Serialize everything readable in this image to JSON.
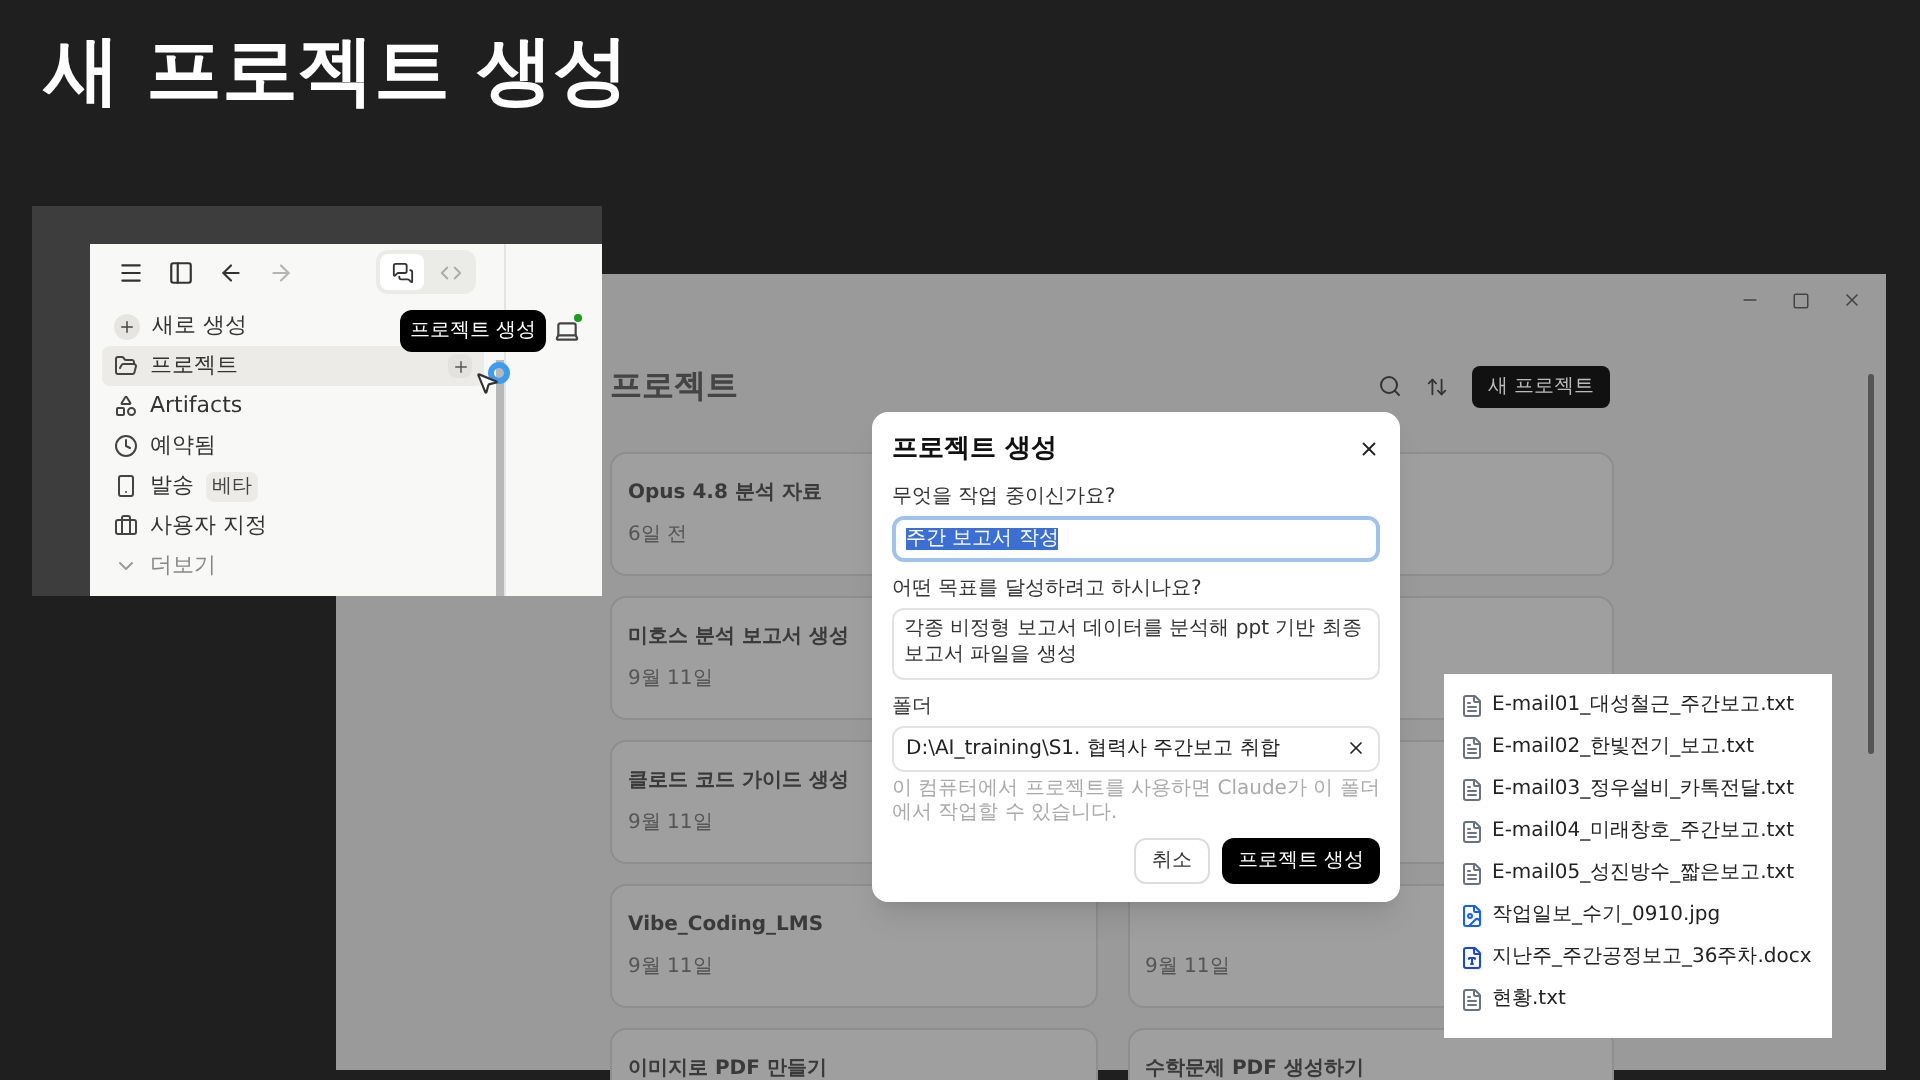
{
  "slide_title": "새 프로젝트 생성",
  "sidebar": {
    "nav": [
      {
        "kind": "menu",
        "disabled": false
      },
      {
        "kind": "panel",
        "disabled": false
      },
      {
        "kind": "back",
        "disabled": false
      },
      {
        "kind": "forward",
        "disabled": true
      }
    ],
    "mode_toggle": [
      {
        "kind": "chat",
        "selected": true
      },
      {
        "kind": "code",
        "selected": false
      }
    ],
    "items": [
      {
        "kind": "new",
        "label": "새로 생성",
        "selected": false
      },
      {
        "kind": "projects",
        "label": "프로젝트",
        "selected": true
      },
      {
        "kind": "artifacts",
        "label": "Artifacts",
        "selected": false
      },
      {
        "kind": "scheduled",
        "label": "예약됨",
        "selected": false
      },
      {
        "kind": "dispatch",
        "label": "발송",
        "badge": "베타",
        "selected": false
      },
      {
        "kind": "customize",
        "label": "사용자 지정",
        "selected": false
      },
      {
        "kind": "more",
        "label": "더보기",
        "selected": false
      }
    ],
    "tooltip": "프로젝트 생성"
  },
  "app": {
    "heading": "프로젝트",
    "new_button": "새 프로젝트",
    "cards_left": [
      {
        "title": "Opus 4.8 분석 자료",
        "date": "6일 전"
      },
      {
        "title": "미호스 분석 보고서 생성",
        "date": "9월 11일"
      },
      {
        "title": "클로드 코드 가이드 생성",
        "date": "9월 11일"
      },
      {
        "title": "Vibe_Coding_LMS",
        "date": "9월 11일"
      },
      {
        "title": "이미지로 PDF 만들기"
      }
    ],
    "cards_right": [
      {
        "date": "9월 11일"
      },
      {
        "title": "수학문제 PDF 생성하기"
      }
    ]
  },
  "dialog": {
    "title": "프로젝트 생성",
    "fields": [
      {
        "kind": "input",
        "label": "무엇을 작업 중이신가요?",
        "value": "주간 보고서 작성",
        "selected": true
      },
      {
        "kind": "textarea",
        "label": "어떤 목표를 달성하려고 하시나요?",
        "value": "각종 비정형 보고서 데이터를 분석해 ppt 기반 최종 보고서 파일을 생성"
      },
      {
        "kind": "folder",
        "label": "폴더",
        "value": "D:\\AI_training\\S1. 협력사 주간보고 취합"
      }
    ],
    "hint": "이 컴퓨터에서 프로젝트를 사용하면 Claude가 이 폴더에서 작업할 수 있습니다.",
    "buttons": [
      {
        "kind": "secondary",
        "label": "취소"
      },
      {
        "kind": "primary",
        "label": "프로젝트 생성"
      }
    ]
  },
  "files": [
    {
      "kind": "text",
      "name": "E-mail01_대성철근_주간보고.txt"
    },
    {
      "kind": "text",
      "name": "E-mail02_한빛전기_보고.txt"
    },
    {
      "kind": "text",
      "name": "E-mail03_정우설비_카톡전달.txt"
    },
    {
      "kind": "text",
      "name": "E-mail04_미래창호_주간보고.txt"
    },
    {
      "kind": "text",
      "name": "E-mail05_성진방수_짧은보고.txt"
    },
    {
      "kind": "image",
      "name": "작업일보_수기_0910.jpg"
    },
    {
      "kind": "word",
      "name": "지난주_주간공정보고_36주차.docx"
    },
    {
      "kind": "text",
      "name": "현황.txt"
    }
  ]
}
